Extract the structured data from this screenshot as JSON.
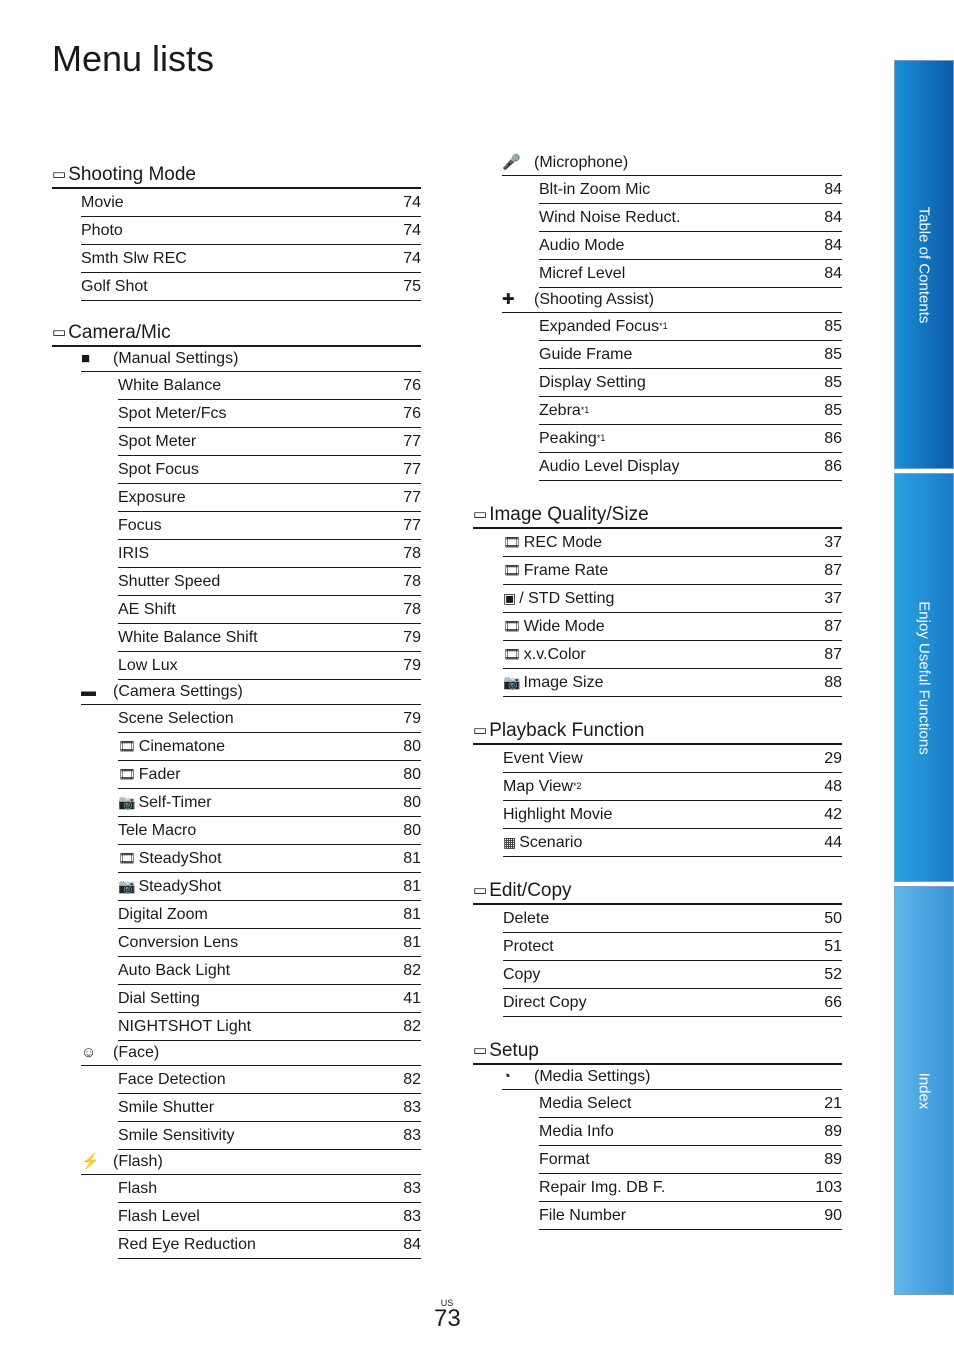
{
  "page_title": "Menu lists",
  "page_number": "73",
  "region": "US",
  "side_tabs": [
    "Table of Contents",
    "Enjoy Useful Functions",
    "Index"
  ],
  "left": {
    "shooting_mode": {
      "title": "Shooting Mode",
      "icon": "shooting-mode-icon",
      "items": [
        {
          "label": "Movie",
          "page": "74"
        },
        {
          "label": "Photo",
          "page": "74"
        },
        {
          "label": "Smth Slw REC",
          "page": "74"
        },
        {
          "label": "Golf Shot",
          "page": "75"
        }
      ]
    },
    "camera_mic": {
      "title": "Camera/Mic",
      "manual": {
        "title": "(Manual Settings)",
        "items": [
          {
            "label": "White Balance",
            "page": "76"
          },
          {
            "label": "Spot Meter/Fcs",
            "page": "76"
          },
          {
            "label": "Spot Meter",
            "page": "77"
          },
          {
            "label": "Spot Focus",
            "page": "77"
          },
          {
            "label": "Exposure",
            "page": "77"
          },
          {
            "label": "Focus",
            "page": "77"
          },
          {
            "label": "IRIS",
            "page": "78"
          },
          {
            "label": "Shutter Speed",
            "page": "78"
          },
          {
            "label": "AE Shift",
            "page": "78"
          },
          {
            "label": "White Balance Shift",
            "page": "79"
          },
          {
            "label": "Low Lux",
            "page": "79"
          }
        ]
      },
      "camera": {
        "title": "(Camera Settings)",
        "items": [
          {
            "label": "Scene Selection",
            "page": "79",
            "icon": ""
          },
          {
            "label": "Cinematone",
            "page": "80",
            "icon": "film"
          },
          {
            "label": "Fader",
            "page": "80",
            "icon": "film"
          },
          {
            "label": "Self-Timer",
            "page": "80",
            "icon": "camera"
          },
          {
            "label": "Tele Macro",
            "page": "80",
            "icon": ""
          },
          {
            "label": "SteadyShot",
            "page": "81",
            "icon": "film"
          },
          {
            "label": "SteadyShot",
            "page": "81",
            "icon": "camera"
          },
          {
            "label": "Digital Zoom",
            "page": "81",
            "icon": ""
          },
          {
            "label": "Conversion Lens",
            "page": "81",
            "icon": ""
          },
          {
            "label": "Auto Back Light",
            "page": "82",
            "icon": ""
          },
          {
            "label": "Dial Setting",
            "page": "41",
            "icon": ""
          },
          {
            "label": "NIGHTSHOT Light",
            "page": "82",
            "icon": ""
          }
        ]
      },
      "face": {
        "title": "(Face)",
        "items": [
          {
            "label": "Face Detection",
            "page": "82"
          },
          {
            "label": "Smile Shutter",
            "page": "83"
          },
          {
            "label": "Smile Sensitivity",
            "page": "83"
          }
        ]
      },
      "flash": {
        "title": "(Flash)",
        "items": [
          {
            "label": "Flash",
            "page": "83"
          },
          {
            "label": "Flash Level",
            "page": "83"
          },
          {
            "label": "Red Eye Reduction",
            "page": "84"
          }
        ]
      }
    }
  },
  "right": {
    "microphone": {
      "title": "(Microphone)",
      "items": [
        {
          "label": "Blt-in Zoom Mic",
          "page": "84"
        },
        {
          "label": "Wind Noise Reduct.",
          "page": "84"
        },
        {
          "label": "Audio Mode",
          "page": "84"
        },
        {
          "label": "Micref Level",
          "page": "84"
        }
      ]
    },
    "assist": {
      "title": "(Shooting Assist)",
      "items": [
        {
          "label": "Expanded Focus",
          "sup": "*1",
          "page": "85"
        },
        {
          "label": "Guide Frame",
          "sup": "",
          "page": "85"
        },
        {
          "label": "Display Setting",
          "sup": "",
          "page": "85"
        },
        {
          "label": "Zebra",
          "sup": "*1",
          "page": "85"
        },
        {
          "label": "Peaking",
          "sup": "*1",
          "page": "86"
        },
        {
          "label": "Audio Level Display",
          "sup": "",
          "page": "86"
        }
      ]
    },
    "image_quality": {
      "title": "Image Quality/Size",
      "items": [
        {
          "label": "REC Mode",
          "page": "37",
          "icon": "film"
        },
        {
          "label": "Frame Rate",
          "page": "87",
          "icon": "film"
        },
        {
          "label": "/ STD Setting",
          "page": "37",
          "icon": "HD"
        },
        {
          "label": "Wide Mode",
          "page": "87",
          "icon": "film"
        },
        {
          "label": "x.v.Color",
          "page": "87",
          "icon": "film"
        },
        {
          "label": "Image Size",
          "page": "88",
          "icon": "camera"
        }
      ]
    },
    "playback": {
      "title": "Playback Function",
      "items": [
        {
          "label": "Event View",
          "sup": "",
          "page": "29",
          "icon": ""
        },
        {
          "label": "Map View",
          "sup": "*2",
          "page": "48",
          "icon": ""
        },
        {
          "label": "Highlight Movie",
          "sup": "",
          "page": "42",
          "icon": ""
        },
        {
          "label": "Scenario",
          "sup": "",
          "page": "44",
          "icon": "scenario"
        }
      ]
    },
    "edit_copy": {
      "title": "Edit/Copy",
      "items": [
        {
          "label": "Delete",
          "page": "50"
        },
        {
          "label": "Protect",
          "page": "51"
        },
        {
          "label": "Copy",
          "page": "52"
        },
        {
          "label": "Direct Copy",
          "page": "66"
        }
      ]
    },
    "setup": {
      "title": "Setup",
      "media": {
        "title": "(Media Settings)",
        "items": [
          {
            "label": "Media Select",
            "page": "21"
          },
          {
            "label": "Media Info",
            "page": "89"
          },
          {
            "label": "Format",
            "page": "89"
          },
          {
            "label": "Repair Img. DB F.",
            "page": "103"
          },
          {
            "label": "File Number",
            "page": "90"
          }
        ]
      }
    }
  }
}
